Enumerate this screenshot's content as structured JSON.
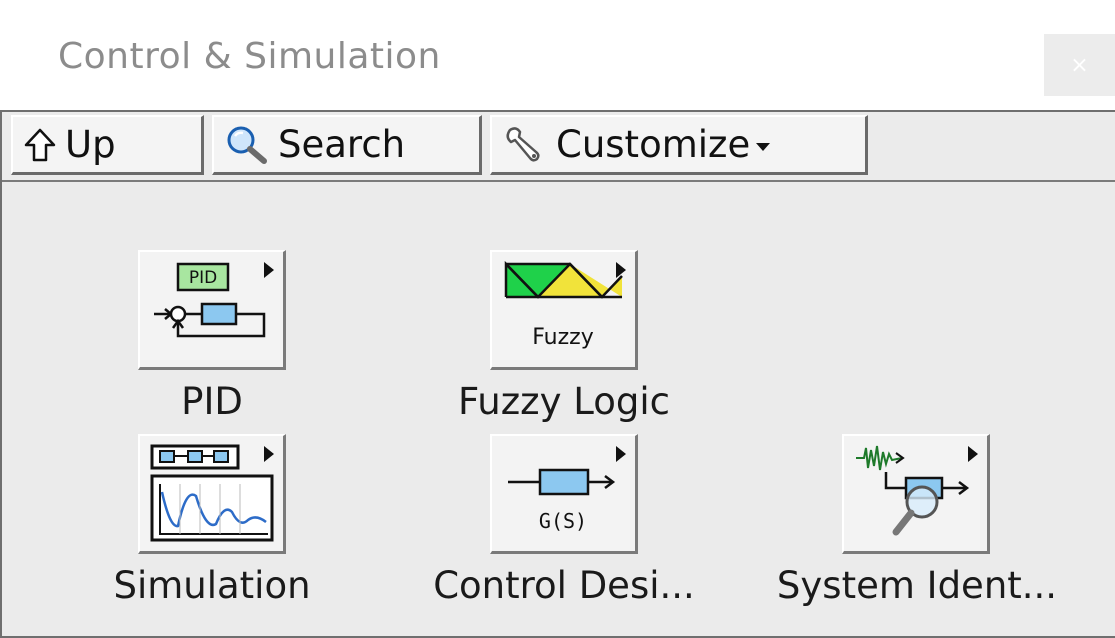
{
  "window": {
    "title": "Control & Simulation",
    "close_label": "×"
  },
  "toolbar": {
    "up_label": "Up",
    "search_label": "Search",
    "customize_label": "Customize"
  },
  "items": [
    {
      "label": "PID",
      "icon": "pid-icon",
      "badge": "PID"
    },
    {
      "label": "Fuzzy Logic",
      "icon": "fuzzy-logic-icon",
      "badge": "Fuzzy"
    },
    {
      "label": "Simulation",
      "icon": "simulation-icon"
    },
    {
      "label": "Control Desi...",
      "icon": "control-design-icon",
      "badge": "G(S)"
    },
    {
      "label": "System Ident...",
      "icon": "system-identification-icon"
    }
  ],
  "colors": {
    "pid_badge_fill": "#a8e6a0",
    "fuzzy_green": "#1fd14a",
    "fuzzy_yellow": "#f1e33a",
    "block_blue": "#8cc8f0",
    "graph_blue": "#2d6cc8",
    "signal_green": "#1e7a2a"
  }
}
